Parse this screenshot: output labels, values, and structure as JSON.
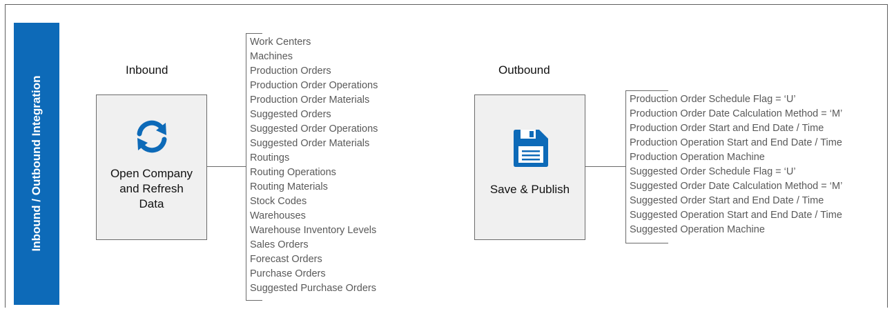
{
  "sidebar": {
    "title": "Inbound / Outbound Integration"
  },
  "inbound": {
    "heading": "Inbound",
    "box_label": "Open Company\nand Refresh\nData",
    "icon": "refresh-icon",
    "items": [
      "Work Centers",
      "Machines",
      "Production Orders",
      "Production Order Operations",
      "Production Order Materials",
      "Suggested Orders",
      "Suggested Order Operations",
      "Suggested Order Materials",
      "Routings",
      "Routing Operations",
      "Routing Materials",
      "Stock Codes",
      "Warehouses",
      "Warehouse Inventory Levels",
      "Sales Orders",
      "Forecast Orders",
      "Purchase Orders",
      "Suggested Purchase Orders"
    ]
  },
  "outbound": {
    "heading": "Outbound",
    "box_label": "Save & Publish",
    "icon": "save-icon",
    "items": [
      "Production Order Schedule Flag = ‘U’",
      "Production Order Date Calculation Method = ‘M’",
      "Production Order Start and End Date / Time",
      "Production Operation Start and End Date / Time",
      "Production Operation Machine",
      "Suggested Order Schedule Flag = ‘U’",
      "Suggested Order Date Calculation Method = ‘M’",
      "Suggested Order Start and End Date / Time",
      "Suggested Operation Start and End Date / Time",
      "Suggested Operation Machine"
    ]
  },
  "colors": {
    "accent": "#0d6ab8",
    "box_fill": "#f0f0f0",
    "list_text": "#595959"
  }
}
